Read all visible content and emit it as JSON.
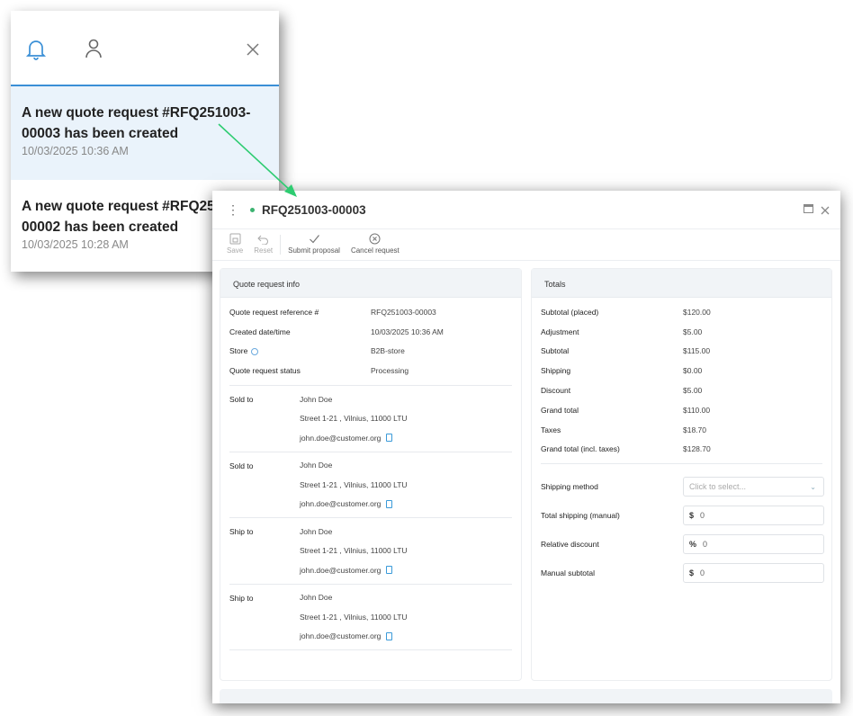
{
  "notifications": {
    "items": [
      {
        "title": "A new quote request #RFQ251003-00003 has been created",
        "time": "10/03/2025 10:36 AM"
      },
      {
        "title": "A new quote request #RFQ251003-00002 has been created",
        "time": "10/03/2025 10:28 AM"
      }
    ]
  },
  "window": {
    "title": "RFQ251003-00003"
  },
  "toolbar": {
    "save": "Save",
    "reset": "Reset",
    "submit": "Submit proposal",
    "cancel": "Cancel request"
  },
  "info": {
    "header": "Quote request info",
    "fields": [
      {
        "label": "Quote request reference #",
        "value": "RFQ251003-00003"
      },
      {
        "label": "Created date/time",
        "value": "10/03/2025 10:36 AM"
      },
      {
        "label": "Store",
        "value": "B2B-store"
      },
      {
        "label": "Quote request status",
        "value": "Processing"
      }
    ],
    "addresses": [
      {
        "label": "Sold to",
        "name": "John Doe",
        "street": "Street 1-21 , Vilnius, 11000 LTU",
        "email": "john.doe@customer.org"
      },
      {
        "label": "Sold to",
        "name": "John Doe",
        "street": "Street 1-21 , Vilnius, 11000 LTU",
        "email": "john.doe@customer.org"
      },
      {
        "label": "Ship to",
        "name": "John Doe",
        "street": "Street 1-21 , Vilnius, 11000 LTU",
        "email": "john.doe@customer.org"
      },
      {
        "label": "Ship to",
        "name": "John Doe",
        "street": "Street 1-21 , Vilnius, 11000 LTU",
        "email": "john.doe@customer.org"
      }
    ]
  },
  "totals": {
    "header": "Totals",
    "rows": [
      {
        "label": "Subtotal (placed)",
        "value": "$120.00"
      },
      {
        "label": "Adjustment",
        "value": "$5.00"
      },
      {
        "label": "Subtotal",
        "value": "$115.00"
      },
      {
        "label": "Shipping",
        "value": "$0.00"
      },
      {
        "label": "Discount",
        "value": "$5.00"
      },
      {
        "label": "Grand total",
        "value": "$110.00"
      },
      {
        "label": "Taxes",
        "value": "$18.70"
      },
      {
        "label": "Grand total (incl. taxes)",
        "value": "$128.70"
      }
    ],
    "shipping_method": {
      "label": "Shipping method",
      "placeholder": "Click to select..."
    },
    "total_shipping": {
      "label": "Total shipping (manual)",
      "prefix": "$",
      "value": "0"
    },
    "relative_discount": {
      "label": "Relative discount",
      "prefix": "%",
      "value": "0"
    },
    "manual_subtotal": {
      "label": "Manual subtotal",
      "prefix": "$",
      "value": "0"
    }
  },
  "colors": {
    "accent": "#3a8fd6",
    "arrow": "#2ecc71",
    "status_dot": "#3cb371"
  }
}
